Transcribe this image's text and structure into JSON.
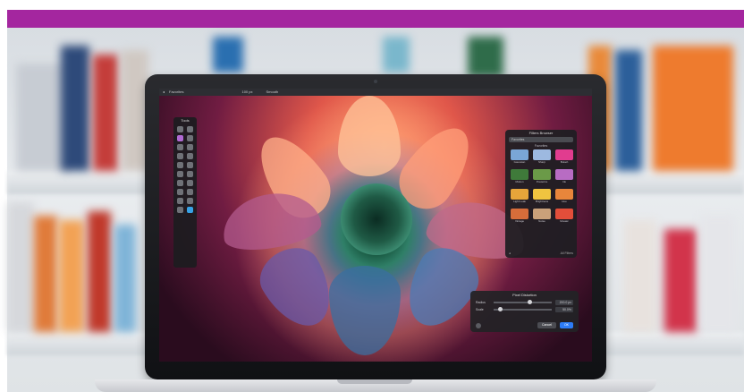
{
  "page": {
    "accent_bar_color": "#a4269f"
  },
  "app": {
    "toolbar_left_label": "Favorites",
    "toolbar_size_label": "100 px",
    "toolbar_mode_label": "Smooth"
  },
  "tools_panel": {
    "title": "Tools",
    "icons": [
      "marquee-rect-icon",
      "lasso-icon",
      "brush-icon",
      "eraser-icon",
      "clone-icon",
      "heal-icon",
      "pen-icon",
      "text-icon",
      "paint-bucket-icon",
      "gradient-icon",
      "smudge-icon",
      "blur-icon",
      "sharpen-icon",
      "dodge-icon",
      "burn-icon",
      "sponge-icon",
      "crop-icon",
      "zoom-icon",
      "hand-icon",
      "color-picker-icon"
    ]
  },
  "filters_browser": {
    "title": "Filters Browser",
    "search_placeholder": "Favorites",
    "section_label": "Favorites",
    "filters": [
      {
        "label": "Gaussian",
        "color": "#7aa6d6"
      },
      {
        "label": "Sharp",
        "color": "#9db9e0"
      },
      {
        "label": "Bokeh",
        "color": "#e13c8f"
      },
      {
        "label": "Motion",
        "color": "#3f7a3a"
      },
      {
        "label": "Posterize",
        "color": "#6b9a48"
      },
      {
        "label": "Ink",
        "color": "#b86cc3"
      },
      {
        "label": "Light Leak",
        "color": "#e7a53a"
      },
      {
        "label": "Brightness",
        "color": "#f0c440"
      },
      {
        "label": "Hue",
        "color": "#e8863b"
      },
      {
        "label": "Vintage",
        "color": "#d76d3a"
      },
      {
        "label": "Noise",
        "color": "#caa17a"
      },
      {
        "label": "Mosaic",
        "color": "#e24e3a"
      }
    ],
    "footer_left": "◂",
    "footer_right": "All Filters"
  },
  "pixel_dialog": {
    "title": "Pixel Distortion",
    "rows": [
      {
        "label": "Radius",
        "value": "200.0 px",
        "knob_fraction": 0.62
      },
      {
        "label": "Scale",
        "value": "50.0%",
        "knob_fraction": 0.12
      }
    ],
    "cancel_label": "Cancel",
    "ok_label": "OK"
  }
}
